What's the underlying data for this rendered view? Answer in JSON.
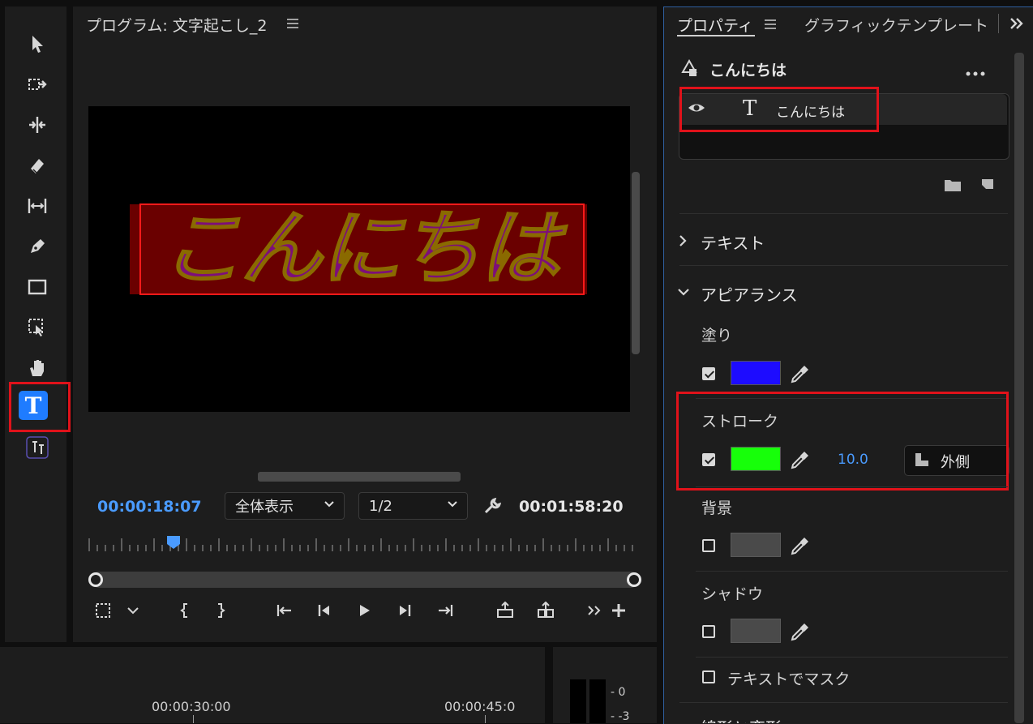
{
  "program": {
    "title": "プログラム: 文字起こし_2",
    "menu_icon": "hamburger-menu-icon",
    "text_overlay": "こんにちは",
    "current_time": "00:00:18:07",
    "zoom_select": "全体表示",
    "resolution_select": "1/2",
    "duration": "00:01:58:20",
    "playhead_fraction": 0.155
  },
  "tools": [
    "selection-tool-icon",
    "track-select-forward-icon",
    "ripple-edit-icon",
    "razor-icon",
    "slip-icon",
    "pen-icon",
    "rectangle-icon",
    "transform-icon",
    "hand-icon",
    "type-tool-icon",
    "vertical-type-icon"
  ],
  "timeline": {
    "ruler_a": "00:00:30:00",
    "ruler_b": "00:00:45:0",
    "meter_0": "- 0",
    "meter_3": "- -3"
  },
  "properties": {
    "tab_properties": "プロパティ",
    "tab_graphics": "グラフィックテンプレート",
    "layer_group": "こんにちは",
    "layer_item": "こんにちは",
    "section_text": "テキスト",
    "section_appearance": "アピアランス",
    "fill_label": "塗り",
    "fill_color": "#1d0cff",
    "stroke_label": "ストローク",
    "stroke_color": "#17ff0a",
    "stroke_width": "10.0",
    "stroke_position": "外側",
    "background_label": "背景",
    "shadow_label": "シャドウ",
    "mask_label": "テキストでマスク",
    "bottom_partial": "線形と変形"
  },
  "colors": {
    "accent": "#1f7cff",
    "highlight": "#e0121a",
    "timecode_blue": "#4a9bff",
    "overlay_text": "#7d0e7a",
    "overlay_bg": "#6a0000"
  }
}
